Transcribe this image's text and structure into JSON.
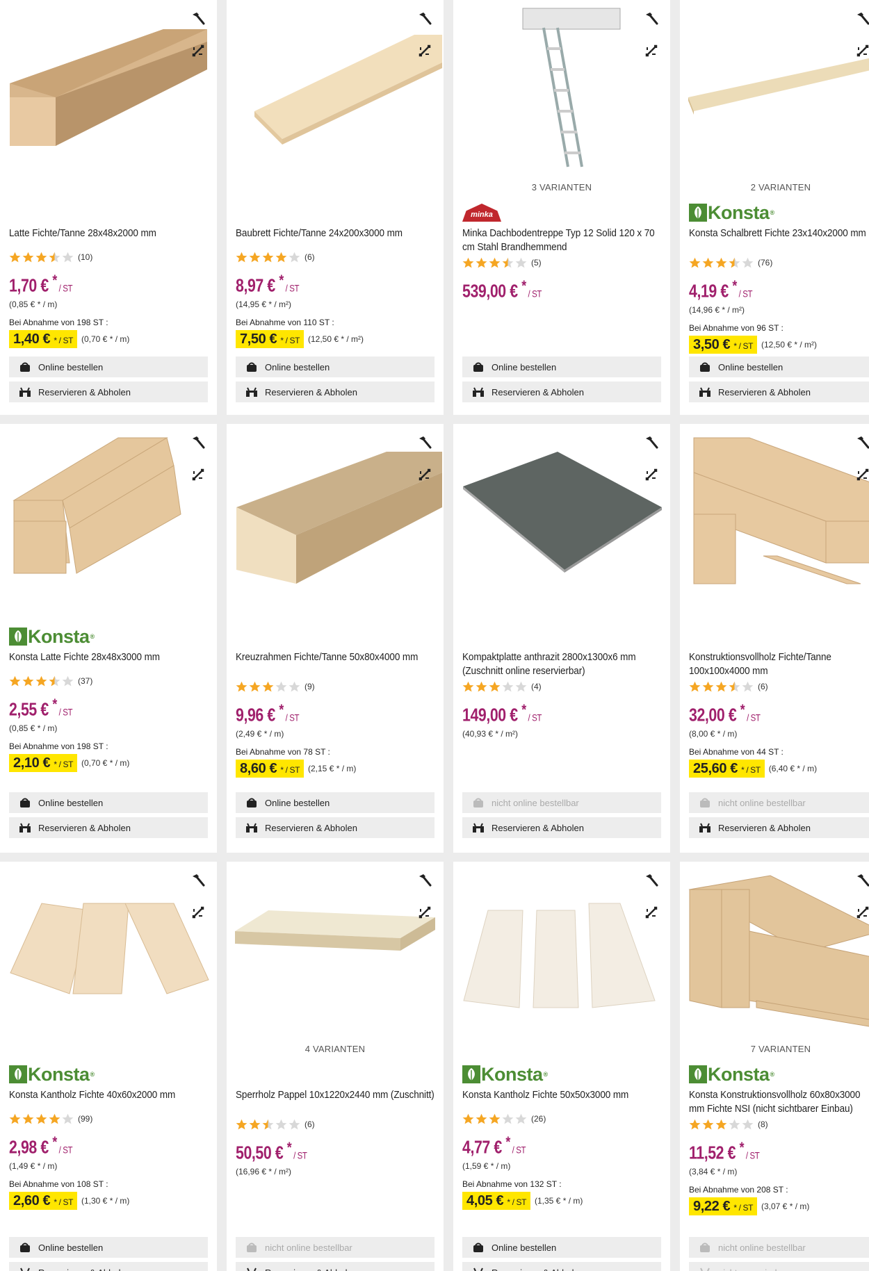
{
  "icons": {
    "hammer": "hammer-icon",
    "compare": "compare-arrows-icon",
    "cart": "cart-icon",
    "store": "store-icon",
    "star": "star-icon"
  },
  "colors": {
    "price": "#a0206c",
    "bulk_bg": "#ffe600",
    "star": "#f5a623",
    "konsta": "#4c8d34"
  },
  "products": [
    {
      "title": "Latte Fichte/Tanne 28x48x2000 mm",
      "rating": 3.5,
      "reviews": "(10)",
      "price": "1,70 €",
      "star_mark": "*",
      "unit": "/ ST",
      "base_price": "(0,85 € * / m)",
      "bulk_label": "Bei Abnahme von 198 ST :",
      "bulk_price": "1,40 €",
      "bulk_unit": "* / ST",
      "bulk_base": "(0,70 € * / m)",
      "online": "Online bestellen",
      "online_enabled": true,
      "reserve": "Reservieren & Abholen",
      "reserve_enabled": true,
      "variants": "",
      "brand": ""
    },
    {
      "title": "Baubrett Fichte/Tanne 24x200x3000 mm",
      "rating": 4,
      "reviews": "(6)",
      "price": "8,97 €",
      "star_mark": "*",
      "unit": "/ ST",
      "base_price": "(14,95 € * / m²)",
      "bulk_label": "Bei Abnahme von 110 ST :",
      "bulk_price": "7,50 €",
      "bulk_unit": "* / ST",
      "bulk_base": "(12,50 € * / m²)",
      "online": "Online bestellen",
      "online_enabled": true,
      "reserve": "Reservieren & Abholen",
      "reserve_enabled": true,
      "variants": "",
      "brand": ""
    },
    {
      "title": "Minka Dachbodentreppe Typ 12 Solid 120 x 70 cm Stahl Brandhemmend",
      "rating": 3.5,
      "reviews": "(5)",
      "price": "539,00 €",
      "star_mark": "*",
      "unit": "/ ST",
      "base_price": "",
      "bulk_label": "",
      "bulk_price": "",
      "bulk_unit": "",
      "bulk_base": "",
      "online": "Online bestellen",
      "online_enabled": true,
      "reserve": "Reservieren & Abholen",
      "reserve_enabled": true,
      "variants": "3 VARIANTEN",
      "brand": "minka"
    },
    {
      "title": "Konsta Schalbrett Fichte 23x140x2000 mm",
      "rating": 3.5,
      "reviews": "(76)",
      "price": "4,19 €",
      "star_mark": "*",
      "unit": "/ ST",
      "base_price": "(14,96 € * / m²)",
      "bulk_label": "Bei Abnahme von 96 ST :",
      "bulk_price": "3,50 €",
      "bulk_unit": "* / ST",
      "bulk_base": "(12,50 € * / m²)",
      "online": "Online bestellen",
      "online_enabled": true,
      "reserve": "Reservieren & Abholen",
      "reserve_enabled": true,
      "variants": "2 VARIANTEN",
      "brand": "konsta"
    },
    {
      "title": "Konsta Latte Fichte 28x48x3000 mm",
      "rating": 3.5,
      "reviews": "(37)",
      "price": "2,55 €",
      "star_mark": "*",
      "unit": "/ ST",
      "base_price": "(0,85 € * / m)",
      "bulk_label": "Bei Abnahme von 198 ST :",
      "bulk_price": "2,10 €",
      "bulk_unit": "* / ST",
      "bulk_base": "(0,70 € * / m)",
      "online": "Online bestellen",
      "online_enabled": true,
      "reserve": "Reservieren & Abholen",
      "reserve_enabled": true,
      "variants": "",
      "brand": "konsta"
    },
    {
      "title": "Kreuzrahmen Fichte/Tanne 50x80x4000 mm",
      "rating": 3,
      "reviews": "(9)",
      "price": "9,96 €",
      "star_mark": "*",
      "unit": "/ ST",
      "base_price": "(2,49 € * / m)",
      "bulk_label": "Bei Abnahme von 78 ST :",
      "bulk_price": "8,60 €",
      "bulk_unit": "* / ST",
      "bulk_base": "(2,15 € * / m)",
      "online": "Online bestellen",
      "online_enabled": true,
      "reserve": "Reservieren & Abholen",
      "reserve_enabled": true,
      "variants": "",
      "brand": ""
    },
    {
      "title": "Kompaktplatte anthrazit 2800x1300x6 mm (Zuschnitt online reservierbar)",
      "rating": 3,
      "reviews": "(4)",
      "price": "149,00 €",
      "star_mark": "*",
      "unit": "/ ST",
      "base_price": "(40,93 € * / m²)",
      "bulk_label": "",
      "bulk_price": "",
      "bulk_unit": "",
      "bulk_base": "",
      "online": "nicht online bestellbar",
      "online_enabled": false,
      "reserve": "Reservieren & Abholen",
      "reserve_enabled": true,
      "variants": "",
      "brand": ""
    },
    {
      "title": "Konstruktionsvollholz Fichte/Tanne 100x100x4000 mm",
      "rating": 3.5,
      "reviews": "(6)",
      "price": "32,00 €",
      "star_mark": "*",
      "unit": "/ ST",
      "base_price": "(8,00 € * / m)",
      "bulk_label": "Bei Abnahme von 44 ST :",
      "bulk_price": "25,60 €",
      "bulk_unit": "* / ST",
      "bulk_base": "(6,40 € * / m)",
      "online": "nicht online bestellbar",
      "online_enabled": false,
      "reserve": "Reservieren & Abholen",
      "reserve_enabled": true,
      "variants": "",
      "brand": ""
    },
    {
      "title": "Konsta Kantholz Fichte 40x60x2000 mm",
      "rating": 4,
      "reviews": "(99)",
      "price": "2,98 €",
      "star_mark": "*",
      "unit": "/ ST",
      "base_price": "(1,49 € * / m)",
      "bulk_label": "Bei Abnahme von 108 ST :",
      "bulk_price": "2,60 €",
      "bulk_unit": "* / ST",
      "bulk_base": "(1,30 € * / m)",
      "online": "Online bestellen",
      "online_enabled": true,
      "reserve": "Reservieren & Abholen",
      "reserve_enabled": true,
      "variants": "",
      "brand": "konsta"
    },
    {
      "title": "Sperrholz Pappel 10x1220x2440 mm (Zuschnitt)",
      "rating": 2.5,
      "reviews": "(6)",
      "price": "50,50 €",
      "star_mark": "*",
      "unit": "/ ST",
      "base_price": "(16,96 € * / m²)",
      "bulk_label": "",
      "bulk_price": "",
      "bulk_unit": "",
      "bulk_base": "",
      "online": "nicht online bestellbar",
      "online_enabled": false,
      "reserve": "Reservieren & Abholen",
      "reserve_enabled": true,
      "variants": "4 VARIANTEN",
      "brand": ""
    },
    {
      "title": "Konsta Kantholz Fichte 50x50x3000 mm",
      "rating": 3,
      "reviews": "(26)",
      "price": "4,77 €",
      "star_mark": "*",
      "unit": "/ ST",
      "base_price": "(1,59 € * / m)",
      "bulk_label": "Bei Abnahme von 132 ST :",
      "bulk_price": "4,05 €",
      "bulk_unit": "* / ST",
      "bulk_base": "(1,35 € * / m)",
      "online": "Online bestellen",
      "online_enabled": true,
      "reserve": "Reservieren & Abholen",
      "reserve_enabled": true,
      "variants": "",
      "brand": "konsta"
    },
    {
      "title": "Konsta Konstruktionsvollholz 60x80x3000 mm Fichte NSI (nicht sichtbarer Einbau)",
      "rating": 3,
      "reviews": "(8)",
      "price": "11,52 €",
      "star_mark": "*",
      "unit": "/ ST",
      "base_price": "(3,84 € * / m)",
      "bulk_label": "Bei Abnahme von 208 ST :",
      "bulk_price": "9,22 €",
      "bulk_unit": "* / ST",
      "bulk_base": "(3,07 € * / m)",
      "online": "nicht online bestellbar",
      "online_enabled": false,
      "reserve": "nicht reservierbar",
      "reserve_enabled": false,
      "variants": "7 VARIANTEN",
      "brand": "konsta"
    }
  ],
  "brand_labels": {
    "konsta": "Konsta",
    "minka": "minka"
  }
}
